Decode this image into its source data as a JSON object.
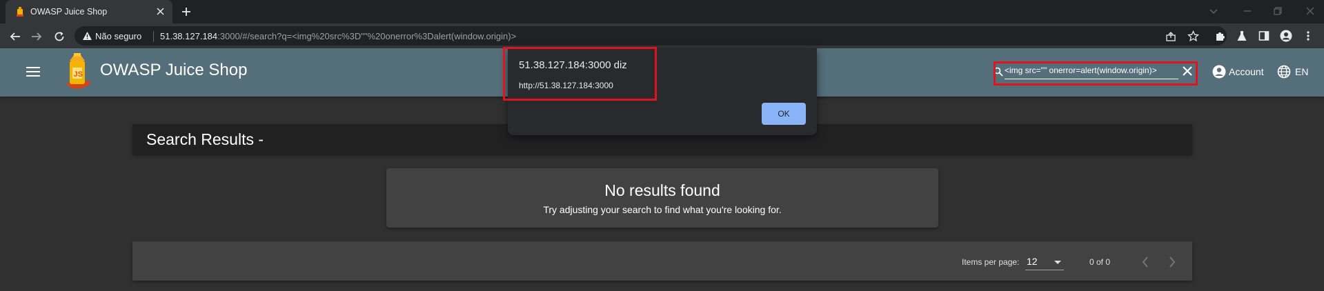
{
  "browser": {
    "tab_title": "OWASP Juice Shop",
    "security_label": "Não seguro",
    "url_host": "51.38.127.184",
    "url_rest": ":3000/#/search?q=<img%20src%3D\"\"%20onerror%3Dalert(window.origin)>"
  },
  "app": {
    "title": "OWASP Juice Shop",
    "search_value": "<img src=\"\" onerror=alert(window.origin)>",
    "account_label": "Account",
    "language_label": "EN"
  },
  "results": {
    "title": "Search Results -",
    "empty_title": "No results found",
    "empty_subtitle": "Try adjusting your search to find what you're looking for."
  },
  "paginator": {
    "items_per_page_label": "Items per page:",
    "items_per_page_value": "12",
    "range_label": "0 of 0"
  },
  "dialog": {
    "origin_text": "51.38.127.184:3000 diz",
    "message": "http://51.38.127.184:3000",
    "ok_label": "OK"
  },
  "colors": {
    "toolbar": "#546e7a",
    "background": "#303030",
    "ok_button": "#8ab4f8",
    "highlight": "#e0141e"
  }
}
